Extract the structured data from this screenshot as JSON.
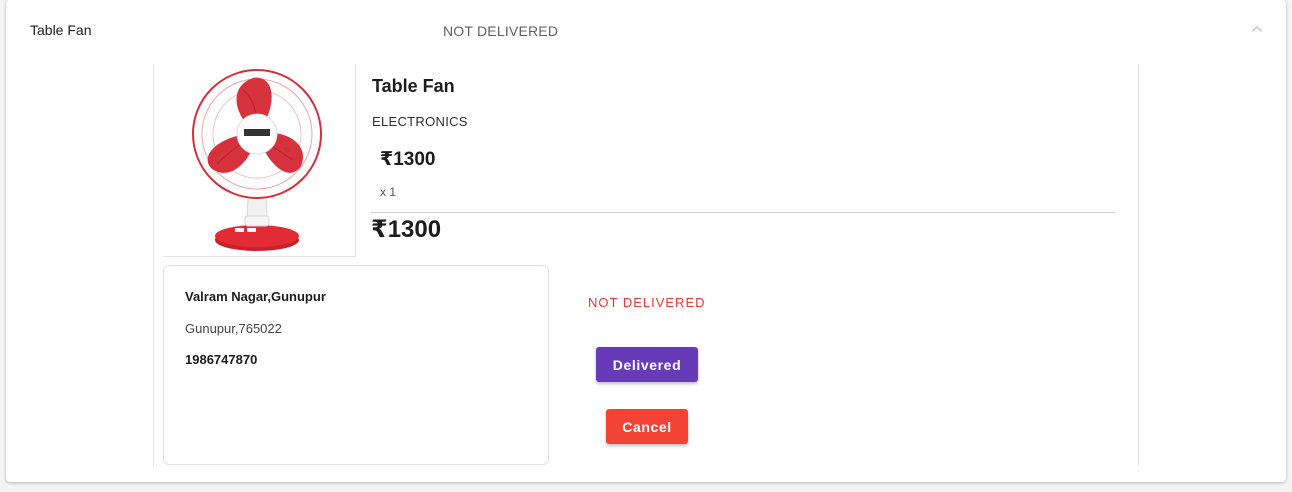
{
  "summary": {
    "title": "Table Fan",
    "status": "NOT DELIVERED",
    "toggle_icon": "chevron-up-icon"
  },
  "product": {
    "name": "Table Fan",
    "category": "ELECTRONICS",
    "price": "₹1300",
    "quantity": "x 1",
    "total": "₹1300",
    "image_icon": "table-fan-image"
  },
  "address": {
    "line1": "Valram Nagar,Gunupur",
    "line2": "Gunupur,765022",
    "phone": "1986747870"
  },
  "order": {
    "status": "NOT DELIVERED",
    "delivered_label": "Delivered",
    "cancel_label": "Cancel"
  },
  "colors": {
    "status_red": "#e53935",
    "delivered_button": "#673ab7",
    "cancel_button": "#f44336",
    "fan_red": "#d32f3a"
  }
}
